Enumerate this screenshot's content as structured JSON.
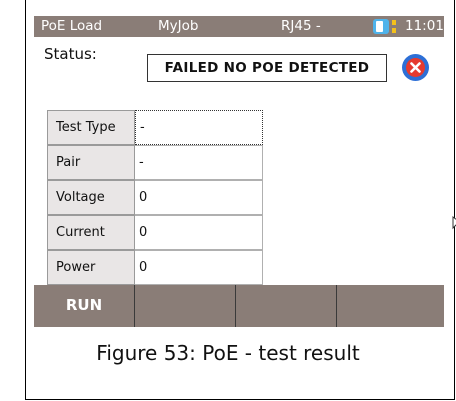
{
  "statusbar": {
    "app": "PoE Load",
    "job": "MyJob",
    "port": "RJ45 -",
    "time": "11:01",
    "battery_icon": "battery-icon"
  },
  "status": {
    "label": "Status:",
    "value": "FAILED NO POE DETECTED",
    "icon": "error-icon"
  },
  "results": [
    {
      "label": "Test Type",
      "value": "-"
    },
    {
      "label": "Pair",
      "value": "-"
    },
    {
      "label": "Voltage",
      "value": "0"
    },
    {
      "label": "Current",
      "value": "0"
    },
    {
      "label": "Power",
      "value": "0"
    }
  ],
  "softkeys": [
    "RUN",
    "",
    "",
    ""
  ],
  "caption": "Figure 53: PoE - test result",
  "colors": {
    "bar": "#8a7d77",
    "error": "#e53a2f",
    "error_ring": "#2d6fd6",
    "battery": "#4fb3ea",
    "battery_level": "#f4c11a"
  }
}
